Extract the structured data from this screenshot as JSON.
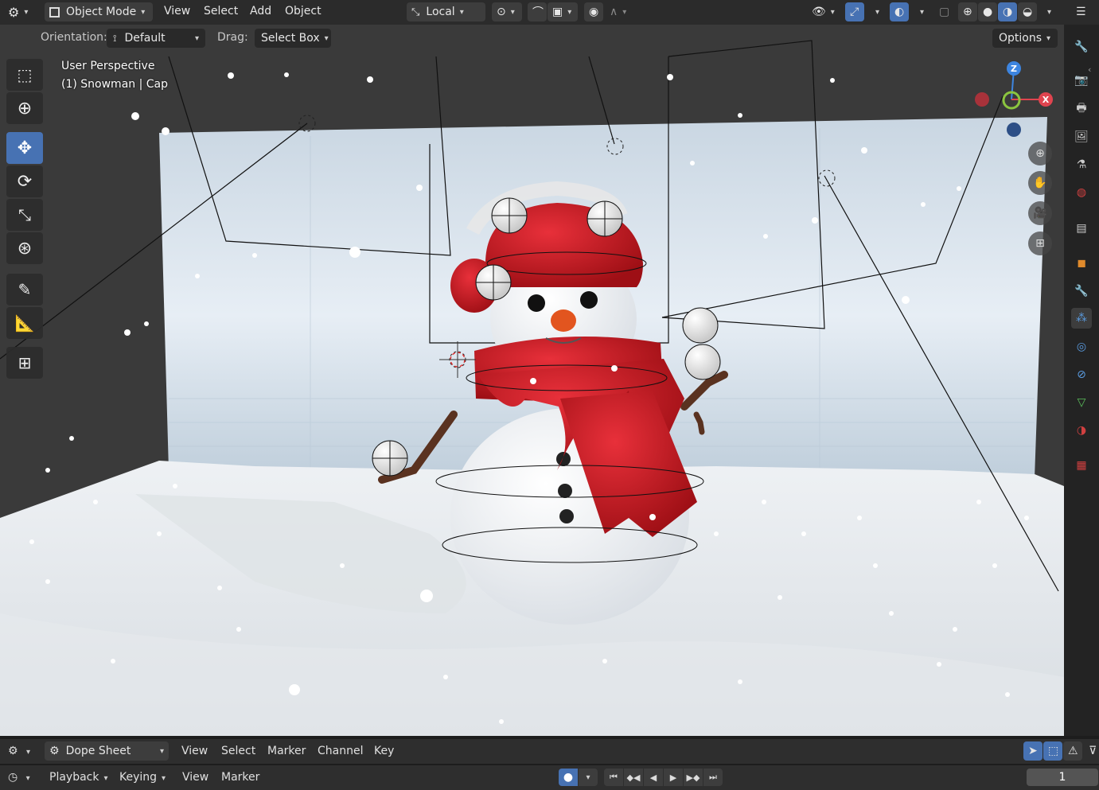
{
  "header": {
    "mode_label": "Object Mode",
    "menus": [
      "View",
      "Select",
      "Add",
      "Object"
    ],
    "transform_orientation": "Local",
    "options_label": "Options"
  },
  "tool_settings": {
    "orientation_label": "Orientation:",
    "orientation_value": "Default",
    "drag_label": "Drag:",
    "drag_value": "Select Box"
  },
  "viewport": {
    "view_name": "User Perspective",
    "object_info": "(1) Snowman | Cap",
    "gizmo_axes": [
      "Z",
      "X"
    ]
  },
  "toolbar": {
    "tools": [
      "select-box",
      "cursor",
      "move",
      "rotate",
      "scale",
      "transform",
      "annotate",
      "measure",
      "add-cube"
    ],
    "active_tool": "move"
  },
  "properties_tabs": [
    "tool",
    "render",
    "output",
    "view-layer",
    "scene",
    "world",
    "collection",
    "object",
    "modifiers",
    "particles",
    "physics",
    "constraints",
    "data",
    "material",
    "texture"
  ],
  "dope_sheet": {
    "editor_label": "Dope Sheet",
    "menus": [
      "View",
      "Select",
      "Marker",
      "Channel",
      "Key"
    ]
  },
  "timeline": {
    "menus": [
      "Playback",
      "Keying",
      "View",
      "Marker"
    ],
    "current_frame": "1"
  },
  "colors": {
    "accent": "#4772b3",
    "axis_x": "#e0444f",
    "axis_y": "#8bc53f",
    "axis_z": "#3d85e0",
    "scarf": "#c8161d",
    "snow": "#f4f6f8"
  }
}
